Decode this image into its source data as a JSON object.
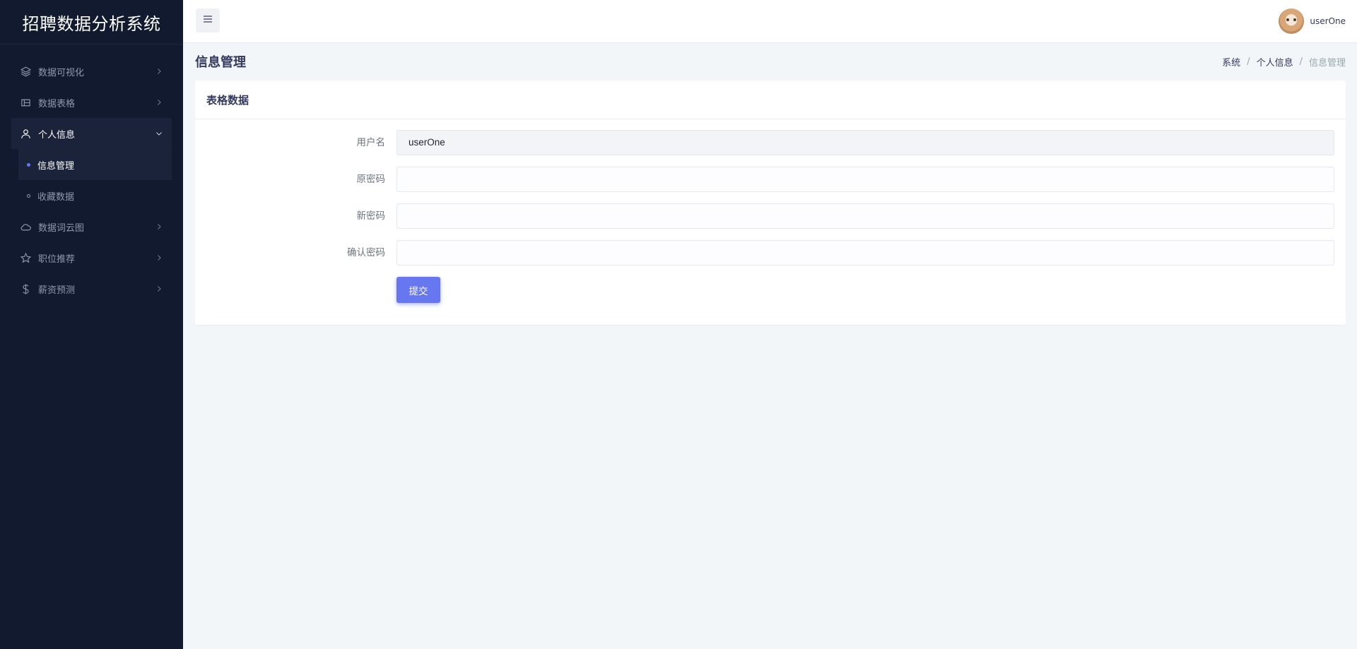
{
  "app": {
    "title": "招聘数据分析系统"
  },
  "sidebar": {
    "items": [
      {
        "label": "数据可视化",
        "icon": "layers-icon"
      },
      {
        "label": "数据表格",
        "icon": "table-icon"
      },
      {
        "label": "个人信息",
        "icon": "user-icon",
        "expanded": true,
        "children": [
          {
            "label": "信息管理",
            "active": true
          },
          {
            "label": "收藏数据",
            "active": false
          }
        ]
      },
      {
        "label": "数据词云图",
        "icon": "cloud-icon"
      },
      {
        "label": "职位推荐",
        "icon": "star-icon"
      },
      {
        "label": "薪资预测",
        "icon": "dollar-icon"
      }
    ]
  },
  "topbar": {
    "menu_toggle_icon": "hamburger-icon",
    "username": "userOne"
  },
  "page": {
    "title": "信息管理",
    "breadcrumb": [
      "系统",
      "个人信息",
      "信息管理"
    ]
  },
  "card": {
    "title": "表格数据",
    "fields": {
      "username": {
        "label": "用户名",
        "value": "userOne"
      },
      "old_password": {
        "label": "原密码",
        "value": ""
      },
      "new_password": {
        "label": "新密码",
        "value": ""
      },
      "confirm_password": {
        "label": "确认密码",
        "value": ""
      }
    },
    "submit_label": "提交"
  },
  "colors": {
    "sidebar_bg": "#111a2e",
    "primary": "#6777ef",
    "page_bg": "#f3f6f9"
  }
}
